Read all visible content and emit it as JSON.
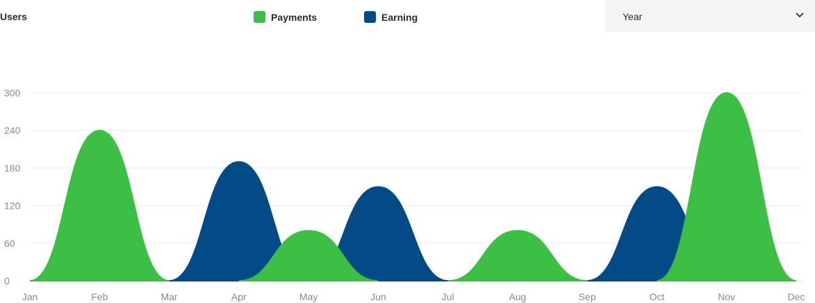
{
  "header": {
    "title": "Users",
    "period_select": {
      "value": "Year",
      "icon": "chevron-down-icon"
    }
  },
  "colors": {
    "payments": "#3dbf45",
    "earning": "#024b87",
    "grid": "#ececec",
    "axis_text": "#8a8a8a"
  },
  "chart_data": {
    "type": "area",
    "categories": [
      "Jan",
      "Feb",
      "Mar",
      "Apr",
      "May",
      "Jun",
      "Jul",
      "Aug",
      "Sep",
      "Oct",
      "Nov",
      "Dec"
    ],
    "series": [
      {
        "name": "Payments",
        "values": [
          0,
          240,
          0,
          null,
          80,
          0,
          0,
          80,
          0,
          null,
          300,
          0
        ],
        "color": "#3dbf45"
      },
      {
        "name": "Earning",
        "values": [
          null,
          null,
          0,
          190,
          null,
          150,
          0,
          null,
          0,
          150,
          0,
          null
        ],
        "color": "#024b87"
      }
    ],
    "peaks": {
      "Payments": [
        {
          "x": "Feb",
          "y": 240,
          "from": "Jan",
          "to": "Mar"
        },
        {
          "x": "May",
          "y": 80,
          "from": "Apr",
          "to": "Jun"
        },
        {
          "x": "Aug",
          "y": 80,
          "from": "Jul",
          "to": "Sep"
        },
        {
          "x": "Nov",
          "y": 300,
          "from": "Oct",
          "to": "Dec"
        }
      ],
      "Earning": [
        {
          "x": "Apr",
          "y": 190,
          "from": "Mar",
          "to": "May"
        },
        {
          "x": "Jun",
          "y": 150,
          "from": "May",
          "to": "Jul"
        },
        {
          "x": "Oct",
          "y": 150,
          "from": "Sep",
          "to": "Nov"
        }
      ]
    },
    "yticks": [
      0,
      60,
      120,
      180,
      240,
      300
    ],
    "ylim": [
      0,
      300
    ],
    "grid": true,
    "legend": "top"
  }
}
